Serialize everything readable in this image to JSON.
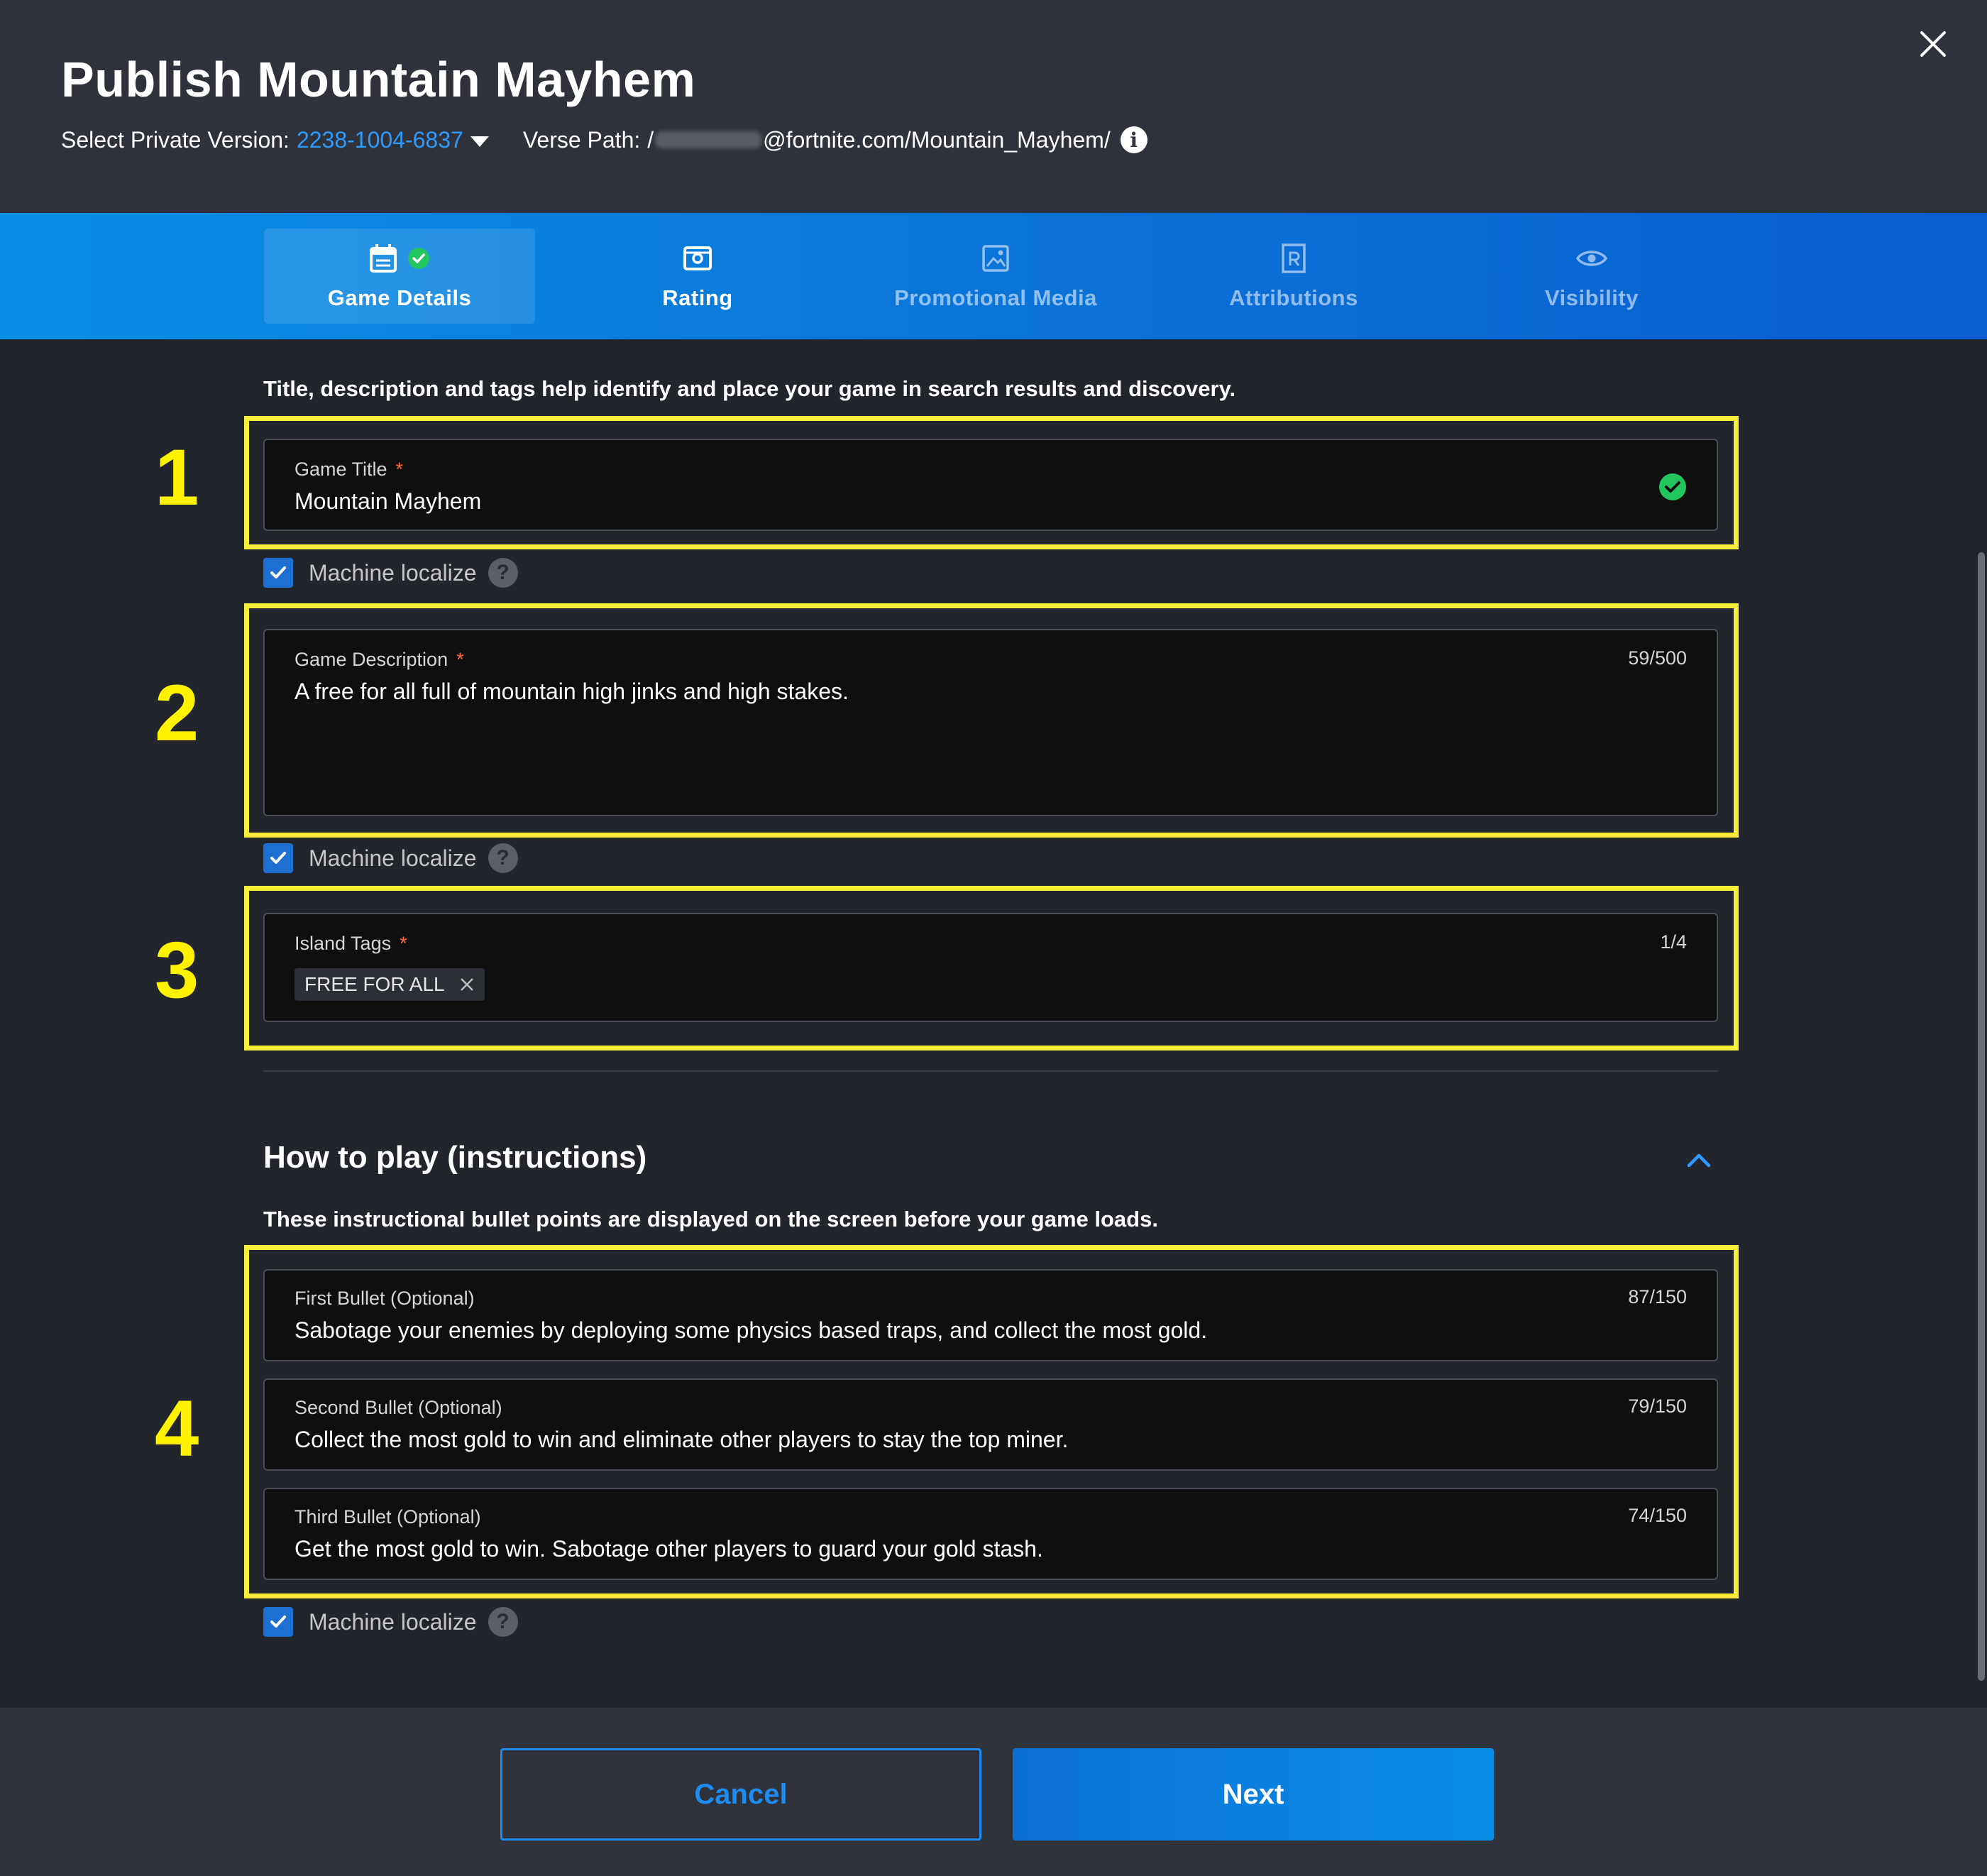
{
  "header": {
    "title": "Publish Mountain Mayhem",
    "version_label": "Select Private Version:",
    "version_value": "2238-1004-6837",
    "verse_label": "Verse Path:",
    "verse_prefix": "/",
    "verse_suffix": "@fortnite.com/Mountain_Mayhem/"
  },
  "tabs": [
    {
      "label": "Game Details",
      "icon": "calendar-icon",
      "active": true,
      "completed": true
    },
    {
      "label": "Rating",
      "icon": "rating-icon"
    },
    {
      "label": "Promotional Media",
      "icon": "image-icon"
    },
    {
      "label": "Attributions",
      "icon": "attributions-icon"
    },
    {
      "label": "Visibility",
      "icon": "eye-icon"
    }
  ],
  "details": {
    "description": "Title, description and tags help identify and place your game in search results and discovery.",
    "title_field": {
      "label": "Game Title",
      "required": "*",
      "value": "Mountain Mayhem"
    },
    "description_field": {
      "label": "Game Description",
      "required": "*",
      "value": "A free for all full of mountain high jinks and high stakes.",
      "count": "59/500"
    },
    "tags_field": {
      "label": "Island Tags",
      "required": "*",
      "tags": [
        "FREE FOR ALL"
      ],
      "count": "1/4"
    },
    "machine_localize": "Machine localize"
  },
  "annotations": [
    "1",
    "2",
    "3",
    "4"
  ],
  "how_to_play": {
    "heading": "How to play (instructions)",
    "description": "These instructional bullet points are displayed on the screen before your game loads.",
    "bullets": [
      {
        "label": "First Bullet (Optional)",
        "value": "Sabotage your enemies by deploying some physics based traps, and collect the most gold.",
        "count": "87/150"
      },
      {
        "label": "Second Bullet (Optional)",
        "value": "Collect the most gold to win and eliminate other players to stay the top miner.",
        "count": "79/150"
      },
      {
        "label": "Third Bullet (Optional)",
        "value": "Get the most gold to win. Sabotage other players to guard your gold stash.",
        "count": "74/150"
      }
    ],
    "machine_localize": "Machine localize"
  },
  "footer": {
    "cancel": "Cancel",
    "next": "Next"
  },
  "colors": {
    "accent": "#0b6fd6",
    "link": "#2f9bff",
    "highlight": "#f7ef3a",
    "success": "#22c55e",
    "required": "#ff6b3d"
  }
}
